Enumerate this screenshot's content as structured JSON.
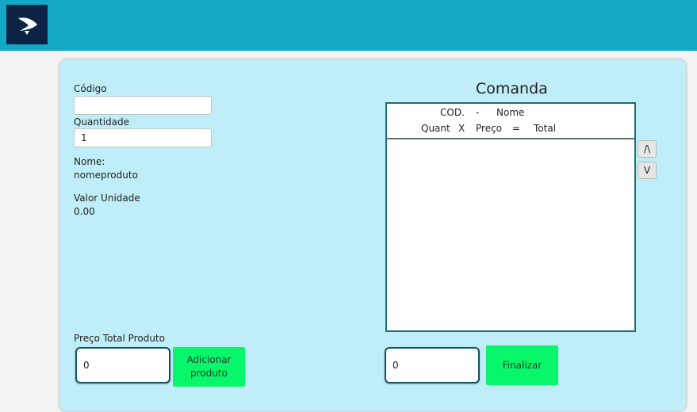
{
  "form": {
    "codigo_label": "Código",
    "codigo_value": "",
    "quantidade_label": "Quantidade",
    "quantidade_value": "1",
    "nome_label": "Nome:",
    "nome_value": "nomeproduto",
    "valor_label": "Valor Unidade",
    "valor_value": "0.00",
    "preco_total_label": "Preço Total Produto",
    "preco_total_value": "0",
    "add_button": "Adicionar produto"
  },
  "comanda": {
    "title": "Comanda",
    "header_cod": "COD.",
    "header_dash": "-",
    "header_nome": "Nome",
    "header_quant": "Quant",
    "header_x": "X",
    "header_preco": "Preço",
    "header_eq": "=",
    "header_total": "Total",
    "items": [],
    "up_button": "/\\",
    "down_button": "V",
    "total_value": "0",
    "finalize_button": "Finalizar"
  },
  "colors": {
    "topbar": "#13a9c5",
    "logo_bg": "#0c2346",
    "panel": "#bfeef8",
    "accent_button": "#08f76a",
    "list_border": "#1b6d77"
  },
  "icons": {
    "logo": "app-logo-icon"
  }
}
